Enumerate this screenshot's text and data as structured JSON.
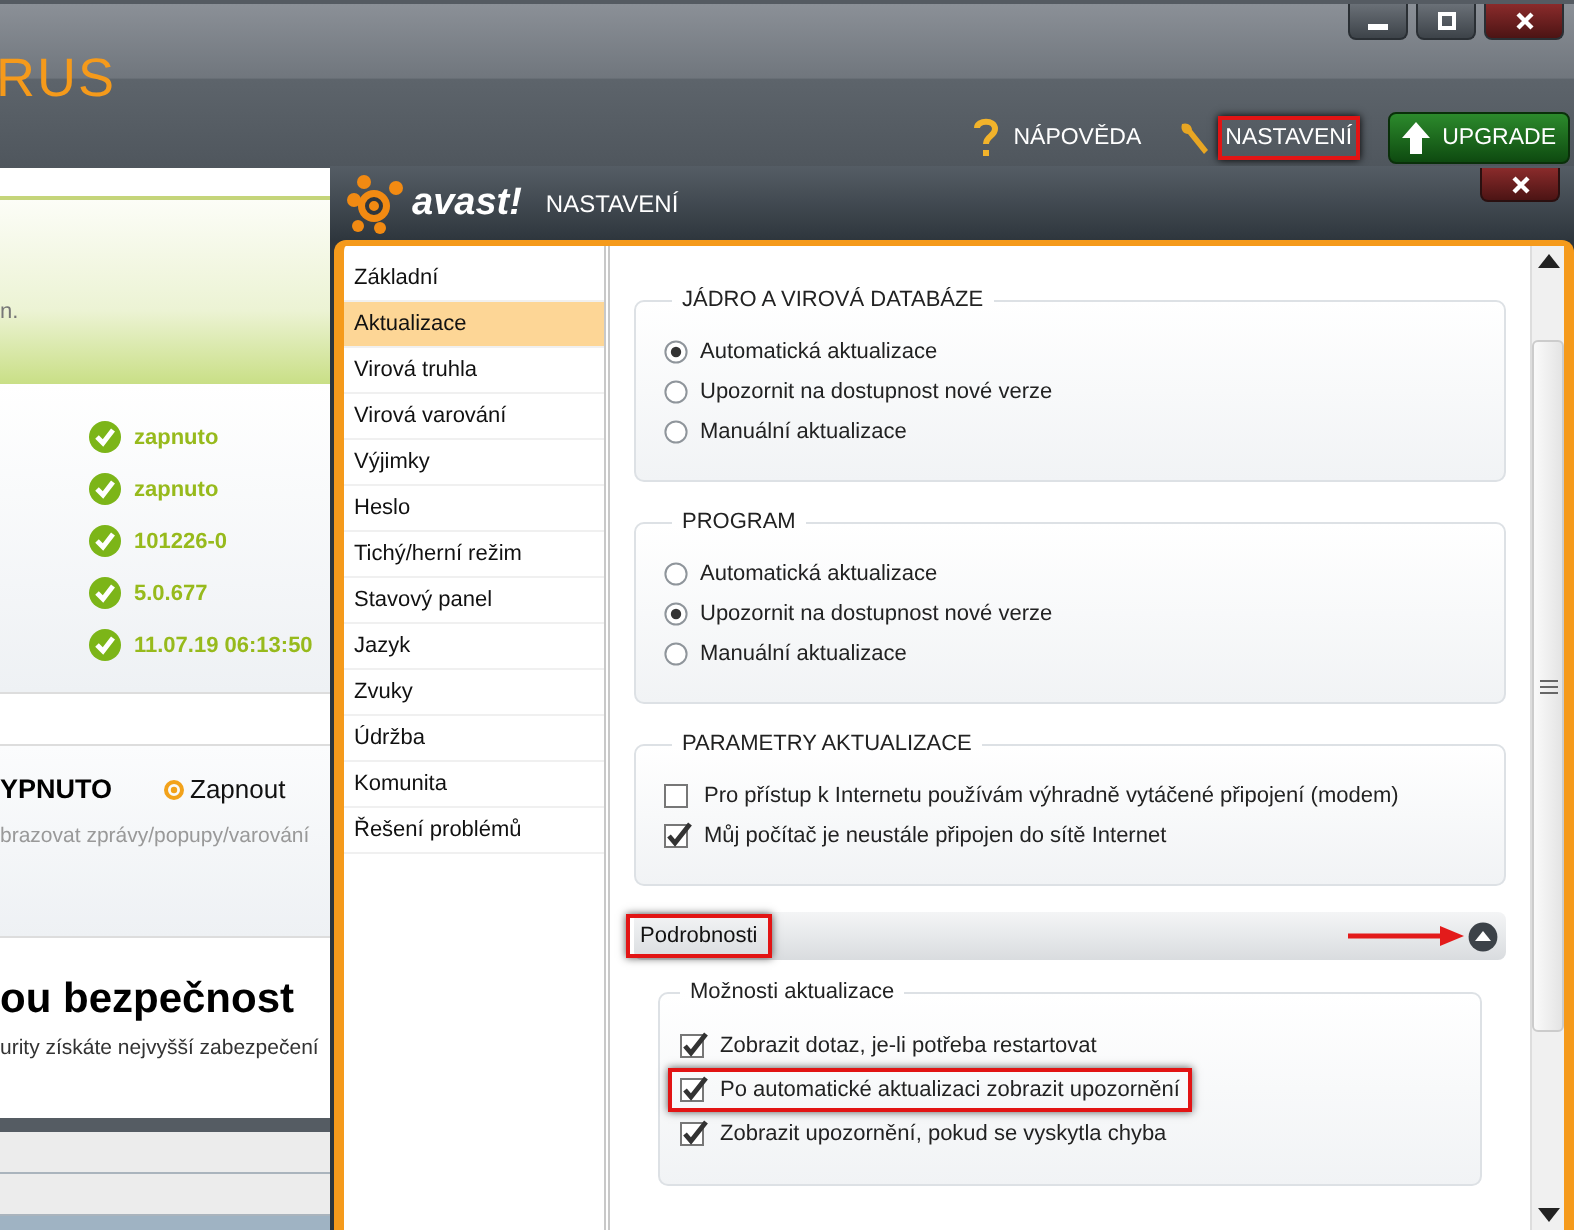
{
  "app": {
    "logo_text": "RUS",
    "toolbar": [
      {
        "kind": "help",
        "label": "NÁPOVĚDA",
        "highlighted": false
      },
      {
        "kind": "settings",
        "label": "NASTAVENÍ",
        "highlighted": true
      },
      {
        "kind": "upgrade",
        "label": "UPGRADE",
        "highlighted": false
      }
    ],
    "banner": {
      "text": "n."
    },
    "status_values": [
      "zapnuto",
      "zapnuto",
      "101226-0",
      "5.0.677",
      "11.07.19 06:13:50"
    ],
    "silent_mode": {
      "state": "YPNUTO",
      "action": "Zapnout",
      "description": "brazovat zprávy/popupy/varování"
    },
    "promo": {
      "heading": "ou bezpečnost",
      "text": "urity získáte nejvyšší zabezpečení"
    }
  },
  "dialog": {
    "logo": "avast!",
    "title": "NASTAVENÍ",
    "sidebar": [
      {
        "label": "Základní",
        "selected": false
      },
      {
        "label": "Aktualizace",
        "selected": true
      },
      {
        "label": "Virová truhla",
        "selected": false
      },
      {
        "label": "Virová varování",
        "selected": false
      },
      {
        "label": "Výjimky",
        "selected": false
      },
      {
        "label": "Heslo",
        "selected": false
      },
      {
        "label": "Tichý/herní režim",
        "selected": false
      },
      {
        "label": "Stavový panel",
        "selected": false
      },
      {
        "label": "Jazyk",
        "selected": false
      },
      {
        "label": "Zvuky",
        "selected": false
      },
      {
        "label": "Údržba",
        "selected": false
      },
      {
        "label": "Komunita",
        "selected": false
      },
      {
        "label": "Řešení problémů",
        "selected": false
      }
    ],
    "groups": [
      {
        "title": "JÁDRO A VIROVÁ DATABÁZE",
        "kind": "radio",
        "options": [
          {
            "label": "Automatická aktualizace",
            "selected": true
          },
          {
            "label": "Upozornit na dostupnost nové verze",
            "selected": false
          },
          {
            "label": "Manuální aktualizace",
            "selected": false
          }
        ]
      },
      {
        "title": "PROGRAM",
        "kind": "radio",
        "options": [
          {
            "label": "Automatická aktualizace",
            "selected": false
          },
          {
            "label": "Upozornit na dostupnost nové verze",
            "selected": true
          },
          {
            "label": "Manuální aktualizace",
            "selected": false
          }
        ]
      },
      {
        "title": "PARAMETRY AKTUALIZACE",
        "kind": "checkbox",
        "options": [
          {
            "label": "Pro přístup k Internetu používám výhradně vytáčené připojení (modem)",
            "checked": false
          },
          {
            "label": "Můj počítač je neustále připojen do sítě Internet",
            "checked": true
          }
        ]
      }
    ],
    "details": {
      "label": "Podrobnosti",
      "expanded": true,
      "highlighted": true,
      "group": {
        "title": "Možnosti aktualizace",
        "options": [
          {
            "label": "Zobrazit dotaz, je-li potřeba restartovat",
            "checked": true,
            "highlighted": false
          },
          {
            "label": "Po automatické aktualizaci zobrazit upozornění",
            "checked": true,
            "highlighted": true
          },
          {
            "label": "Zobrazit upozornění, pokud se vyskytla chyba",
            "checked": true,
            "highlighted": false
          }
        ]
      }
    }
  }
}
